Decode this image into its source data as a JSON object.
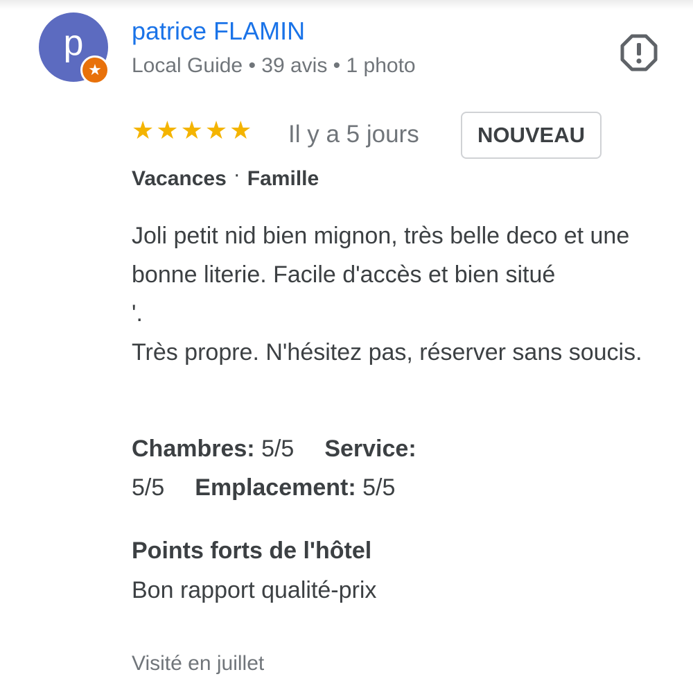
{
  "review": {
    "author": {
      "initial": "p",
      "name": "patrice FLAMIN",
      "meta": "Local Guide • 39 avis • 1 photo",
      "avatar_color": "#5c6bc0",
      "badge_color": "#e8710a",
      "badge_icon": "star-icon"
    },
    "report_icon": "report-octagon-icon",
    "rating": 5,
    "rating_max": 5,
    "stars": [
      "★",
      "★",
      "★",
      "★",
      "★"
    ],
    "star_color": "#f4b400",
    "date": "Il y a 5 jours",
    "badge": "NOUVEAU",
    "trip": {
      "type": "Vacances",
      "separator": "·",
      "company": "Famille"
    },
    "text": "Joli petit nid bien mignon, très belle deco et une bonne literie. Facile d'accès et bien situé\n'.\nTrès propre. N'hésitez pas, réserver sans soucis.",
    "ratings": {
      "rooms_label": "Chambres:",
      "rooms_value": "5/5",
      "service_label": "Service:",
      "service_value": "5/5",
      "location_label": "Emplacement:",
      "location_value": "5/5"
    },
    "highlights": {
      "title": "Points forts de l'hôtel",
      "text": "Bon rapport qualité-prix"
    },
    "visited": "Visité en juillet",
    "accent_color": "#1a73e8"
  }
}
